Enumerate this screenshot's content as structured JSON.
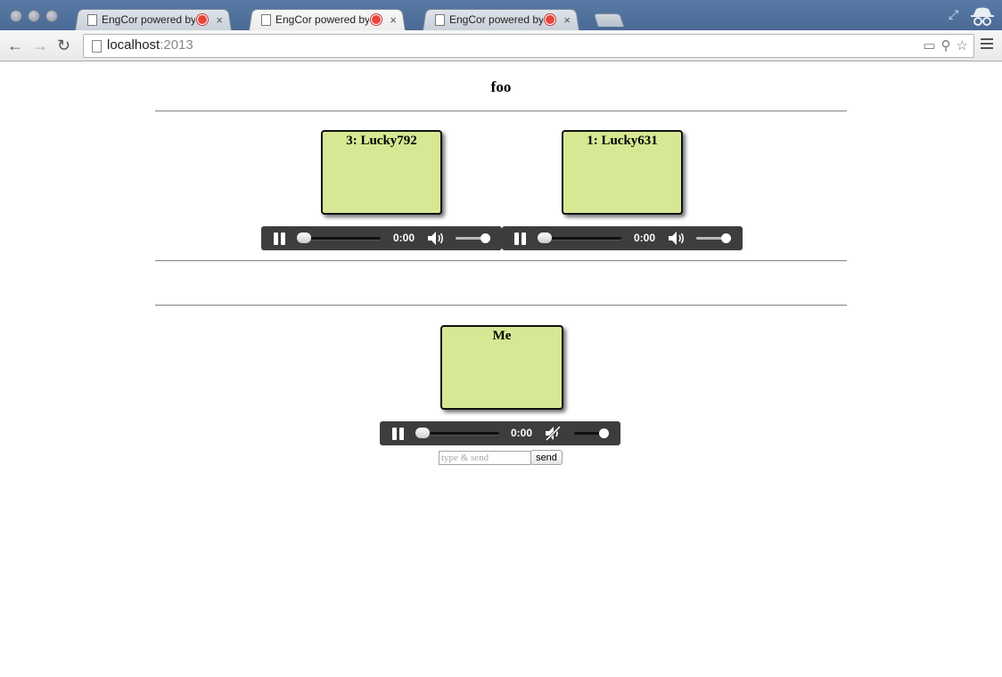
{
  "browser": {
    "tabs": [
      {
        "title": "EngCor powered by WebRTC",
        "close": "×"
      },
      {
        "title": "EngCor powered by WebRTC",
        "close": "×"
      },
      {
        "title": "EngCor powered by WebRTC",
        "close": "×"
      }
    ],
    "active_tab": 1,
    "url_host": "localhost",
    "url_port": ":2013"
  },
  "page": {
    "title": "foo",
    "remote_videos": [
      {
        "label": "3: Lucky792",
        "time": "0:00",
        "progress": 0,
        "volume": 1.0,
        "muted": false
      },
      {
        "label": "1: Lucky631",
        "time": "0:00",
        "progress": 0,
        "volume": 1.0,
        "muted": false
      }
    ],
    "local_video": {
      "label": "Me",
      "time": "0:00",
      "progress": 0,
      "volume": 1.0,
      "muted": true
    },
    "chat": {
      "placeholder": "type & send",
      "send_label": "send"
    }
  }
}
